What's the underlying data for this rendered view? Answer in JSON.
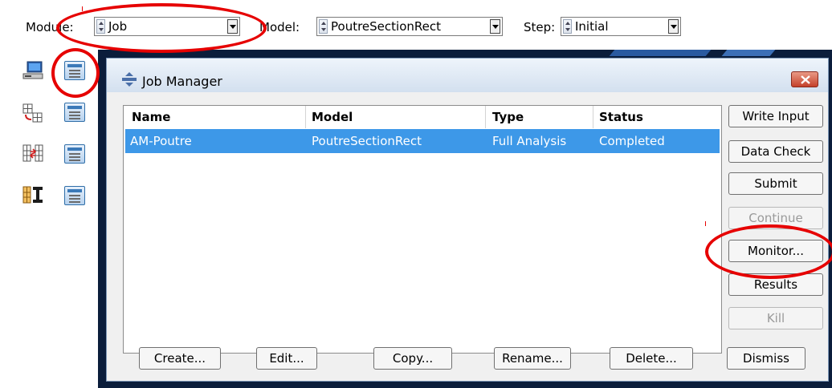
{
  "toolbar": {
    "module_label": "Module:",
    "module_value": "Job",
    "model_label": "Model:",
    "model_value": "PoutreSectionRect",
    "step_label": "Step:",
    "step_value": "Initial"
  },
  "dialog": {
    "title": "Job Manager",
    "columns": [
      "Name",
      "Model",
      "Type",
      "Status"
    ],
    "jobs": [
      {
        "name": "AM-Poutre",
        "model": "PoutreSectionRect",
        "type": "Full Analysis",
        "status": "Completed"
      }
    ],
    "side_buttons": [
      {
        "label": "Write Input",
        "enabled": true
      },
      {
        "label": "Data Check",
        "enabled": true
      },
      {
        "label": "Submit",
        "enabled": true
      },
      {
        "label": "Continue",
        "enabled": false
      },
      {
        "label": "Monitor...",
        "enabled": true
      },
      {
        "label": "Results",
        "enabled": true
      },
      {
        "label": "Kill",
        "enabled": false
      }
    ],
    "bottom_buttons": [
      "Create...",
      "Edit...",
      "Copy...",
      "Rename...",
      "Delete...",
      "Dismiss"
    ]
  },
  "icons": {
    "app": "job-manager-icon",
    "close": "close-icon",
    "left_tools": [
      "workstation-icon",
      "job-manager-icon",
      "mesh-transfer-icon",
      "adaptivity-manager-icon",
      "coexec-icon",
      "coexec-manager-icon",
      "optimization-icon",
      "optimization-manager-icon"
    ]
  },
  "colors": {
    "selection": "#3d98e8",
    "annotation": "#e60000",
    "viewport": "#0b1d3b",
    "dialog_title_bg": "#d3e0ef"
  }
}
